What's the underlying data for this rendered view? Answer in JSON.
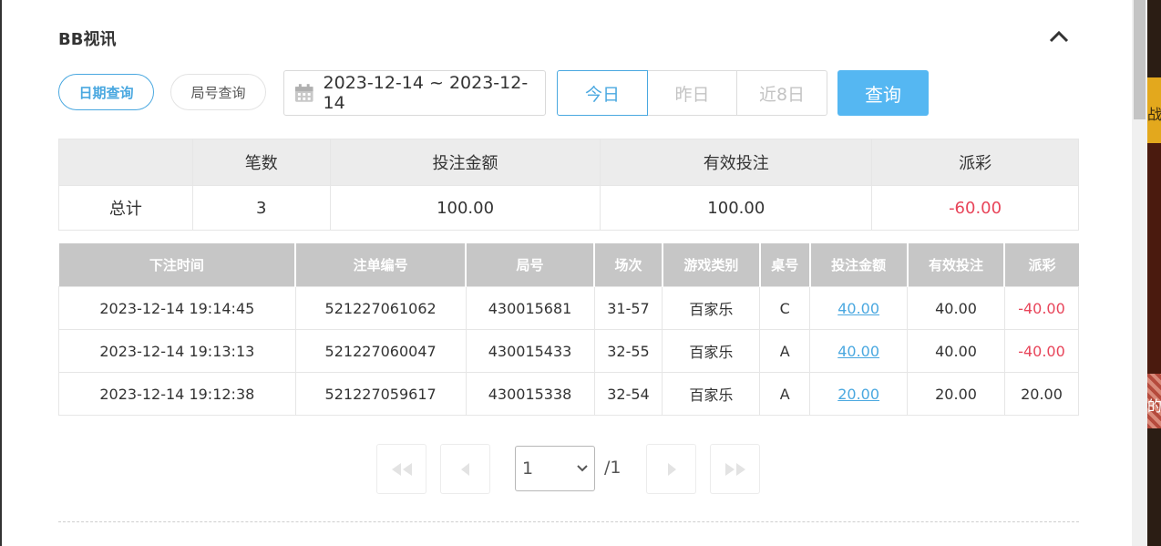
{
  "panel": {
    "title": "BB视讯"
  },
  "filters": {
    "mode_date": "日期查询",
    "mode_round": "局号查询",
    "date_range": "2023-12-14 ~ 2023-12-14",
    "quick": [
      "今日",
      "昨日",
      "近8日"
    ],
    "search": "查询"
  },
  "summary": {
    "headers": [
      "",
      "笔数",
      "投注金额",
      "有效投注",
      "派彩"
    ],
    "row": {
      "label": "总计",
      "count": "3",
      "bet": "100.00",
      "valid": "100.00",
      "payout": "-60.00"
    }
  },
  "detail": {
    "headers": [
      "下注时间",
      "注单编号",
      "局号",
      "场次",
      "游戏类别",
      "桌号",
      "投注金额",
      "有效投注",
      "派彩"
    ],
    "rows": [
      {
        "time": "2023-12-14 19:14:45",
        "order": "521227061062",
        "round": "430015681",
        "session": "31-57",
        "game": "百家乐",
        "table": "C",
        "bet": "40.00",
        "valid": "40.00",
        "payout": "-40.00",
        "negative": true
      },
      {
        "time": "2023-12-14 19:13:13",
        "order": "521227060047",
        "round": "430015433",
        "session": "32-55",
        "game": "百家乐",
        "table": "A",
        "bet": "40.00",
        "valid": "40.00",
        "payout": "-40.00",
        "negative": true
      },
      {
        "time": "2023-12-14 19:12:38",
        "order": "521227059617",
        "round": "430015338",
        "session": "32-54",
        "game": "百家乐",
        "table": "A",
        "bet": "20.00",
        "valid": "20.00",
        "payout": "20.00",
        "negative": false
      }
    ]
  },
  "pagination": {
    "current": "1",
    "total": "/1"
  },
  "side_strip": {
    "text1": "战",
    "text2": "的"
  },
  "colors": {
    "accent": "#4aa8e0",
    "negative": "#e8455a",
    "search_button": "#55b7f2"
  }
}
